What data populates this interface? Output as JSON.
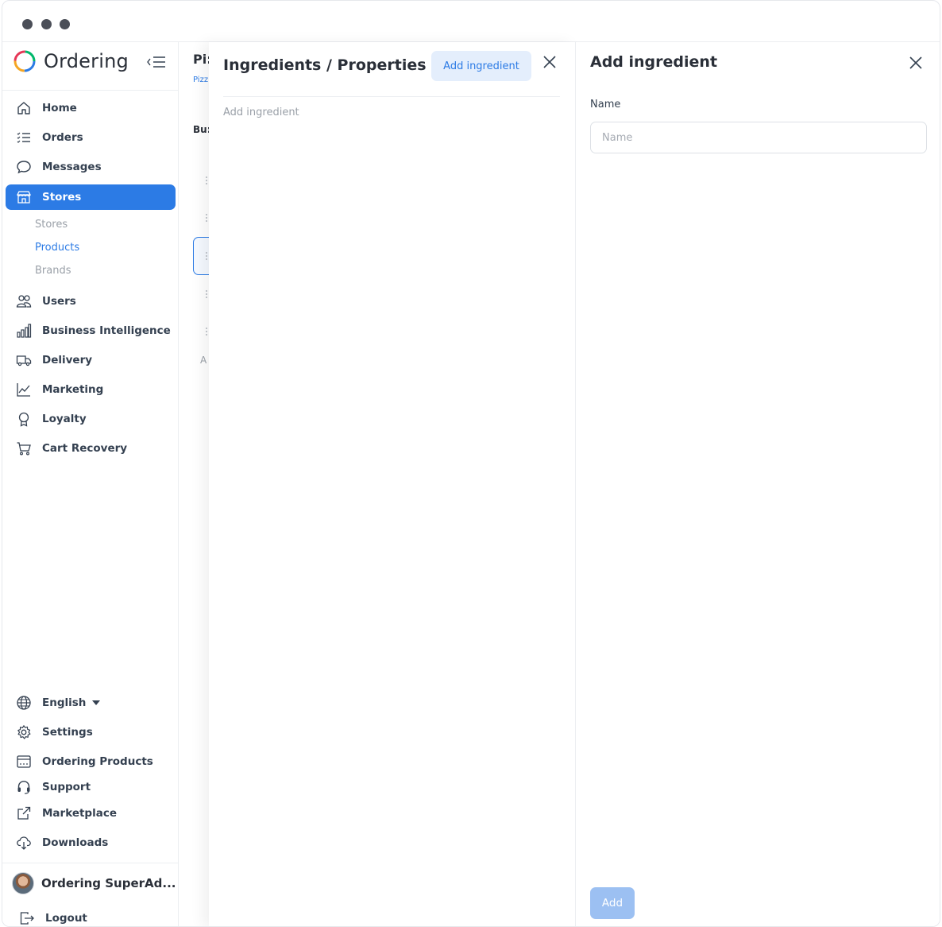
{
  "app": {
    "name": "Ordering"
  },
  "colors": {
    "accent": "#2c7be5",
    "accent_light": "#e4eefc",
    "disabled_button": "#9cc0f2"
  },
  "sidebar": {
    "items": [
      {
        "label": "Home",
        "icon": "home-icon"
      },
      {
        "label": "Orders",
        "icon": "list-icon"
      },
      {
        "label": "Messages",
        "icon": "chat-bubble-icon"
      },
      {
        "label": "Stores",
        "icon": "store-icon",
        "active": true
      },
      {
        "label": "Users",
        "icon": "users-icon"
      },
      {
        "label": "Business Intelligence",
        "icon": "bar-chart-icon"
      },
      {
        "label": "Delivery",
        "icon": "truck-icon"
      },
      {
        "label": "Marketing",
        "icon": "line-chart-icon"
      },
      {
        "label": "Loyalty",
        "icon": "award-icon"
      },
      {
        "label": "Cart Recovery",
        "icon": "cart-icon"
      }
    ],
    "stores_submenu": [
      {
        "label": "Stores"
      },
      {
        "label": "Products",
        "selected": true
      },
      {
        "label": "Brands"
      }
    ],
    "bottom": [
      {
        "label": "English",
        "icon": "globe-icon"
      },
      {
        "label": "Settings",
        "icon": "gear-icon"
      },
      {
        "label": "Ordering Products",
        "icon": "app-window-icon"
      },
      {
        "label": "Support",
        "icon": "headset-icon"
      },
      {
        "label": "Marketplace",
        "icon": "external-link-icon"
      },
      {
        "label": "Downloads",
        "icon": "cloud-download-icon"
      }
    ],
    "user": {
      "name": "Ordering SuperAd..."
    },
    "logout": {
      "label": "Logout",
      "icon": "logout-icon"
    }
  },
  "background_page": {
    "title_fragment": "Pi:",
    "crumb_fragment": "Pizz",
    "section_fragment": "Bu:",
    "add_fragment": "A"
  },
  "ingredients_panel": {
    "title": "Ingredients / Properties",
    "add_button": "Add ingredient",
    "placeholder_text": "Add ingredient"
  },
  "add_ingredient_panel": {
    "title": "Add ingredient",
    "name_label": "Name",
    "name_placeholder": "Name",
    "name_value": "",
    "submit_label": "Add"
  }
}
